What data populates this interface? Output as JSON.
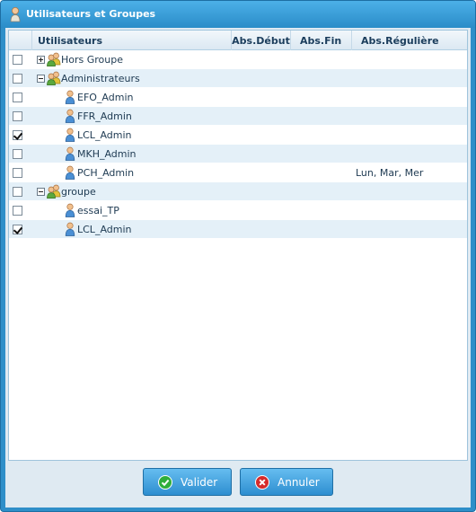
{
  "window": {
    "title": "Utilisateurs et Groupes",
    "icon": "user-icon"
  },
  "columns": {
    "users": "Utilisateurs",
    "debut": "Abs.Début",
    "fin": "Abs.Fin",
    "reguliere": "Abs.Régulière"
  },
  "rows": [
    {
      "label": "Hors Groupe",
      "type": "group",
      "checked": false,
      "expand": "plus",
      "reg": ""
    },
    {
      "label": "Administrateurs",
      "type": "group",
      "checked": false,
      "expand": "minus",
      "reg": ""
    },
    {
      "label": "EFO_Admin",
      "type": "user",
      "checked": false,
      "reg": ""
    },
    {
      "label": "FFR_Admin",
      "type": "user",
      "checked": false,
      "reg": ""
    },
    {
      "label": "LCL_Admin",
      "type": "user",
      "checked": true,
      "reg": ""
    },
    {
      "label": "MKH_Admin",
      "type": "user",
      "checked": false,
      "reg": ""
    },
    {
      "label": "PCH_Admin",
      "type": "user",
      "checked": false,
      "reg": "Lun, Mar, Mer"
    },
    {
      "label": "groupe",
      "type": "group",
      "checked": false,
      "expand": "minus",
      "reg": ""
    },
    {
      "label": "essai_TP",
      "type": "user",
      "checked": false,
      "reg": ""
    },
    {
      "label": "LCL_Admin",
      "type": "user",
      "checked": true,
      "reg": ""
    }
  ],
  "buttons": {
    "ok": {
      "label": "Valider",
      "icon": "check-circle-icon",
      "color": "#2fae3a"
    },
    "cancel": {
      "label": "Annuler",
      "icon": "x-circle-icon",
      "color": "#d62b2b"
    }
  },
  "colors": {
    "titlebar": "#2f8fc9",
    "row_alt": "#e4f0f8",
    "button": "#3c9ddb"
  }
}
